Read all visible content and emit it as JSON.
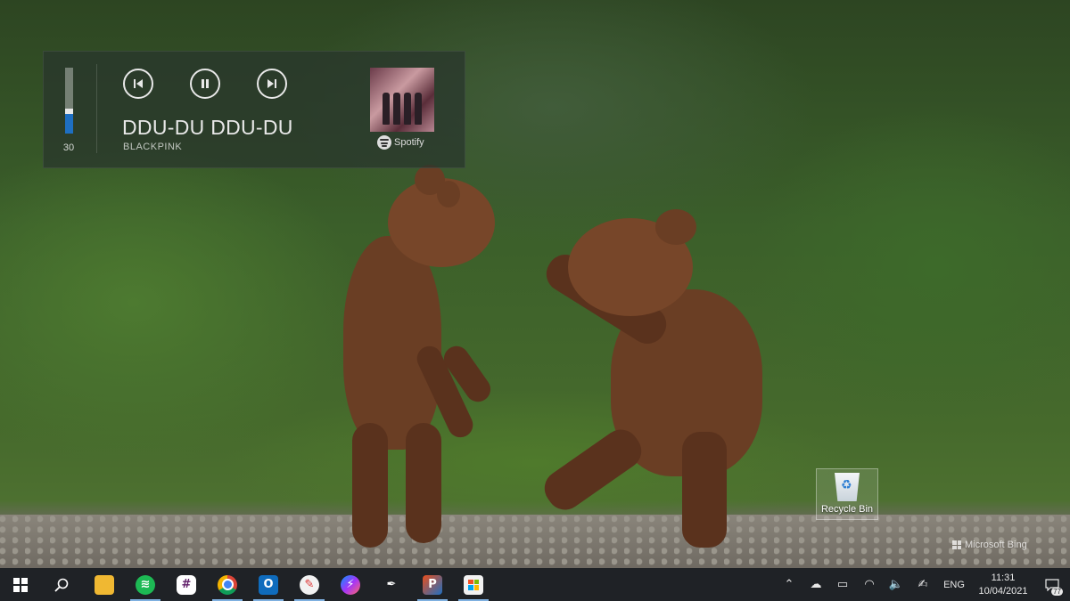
{
  "media": {
    "volume_value": "30",
    "volume_level": 0.3,
    "track_title": "DDU-DU DDU-DU",
    "artist": "BLACKPINK",
    "source_label": "Spotify",
    "icons": [
      "previous-icon",
      "pause-icon",
      "next-icon"
    ]
  },
  "desktop": {
    "recycle_bin_label": "Recycle Bin",
    "watermark": "Microsoft Bing"
  },
  "taskbar": {
    "apps": [
      "start",
      "search",
      "file-explorer",
      "spotify",
      "slack",
      "chrome",
      "outlook",
      "paint",
      "messenger",
      "app-8",
      "app-9",
      "microsoft-store"
    ],
    "lang": "ENG",
    "time": "11:31",
    "date": "10/04/2021",
    "notification_count": "77"
  },
  "colors": {
    "accent": "#1e6fc2",
    "taskbar": "#1f2226",
    "overlay": "#28342c"
  }
}
